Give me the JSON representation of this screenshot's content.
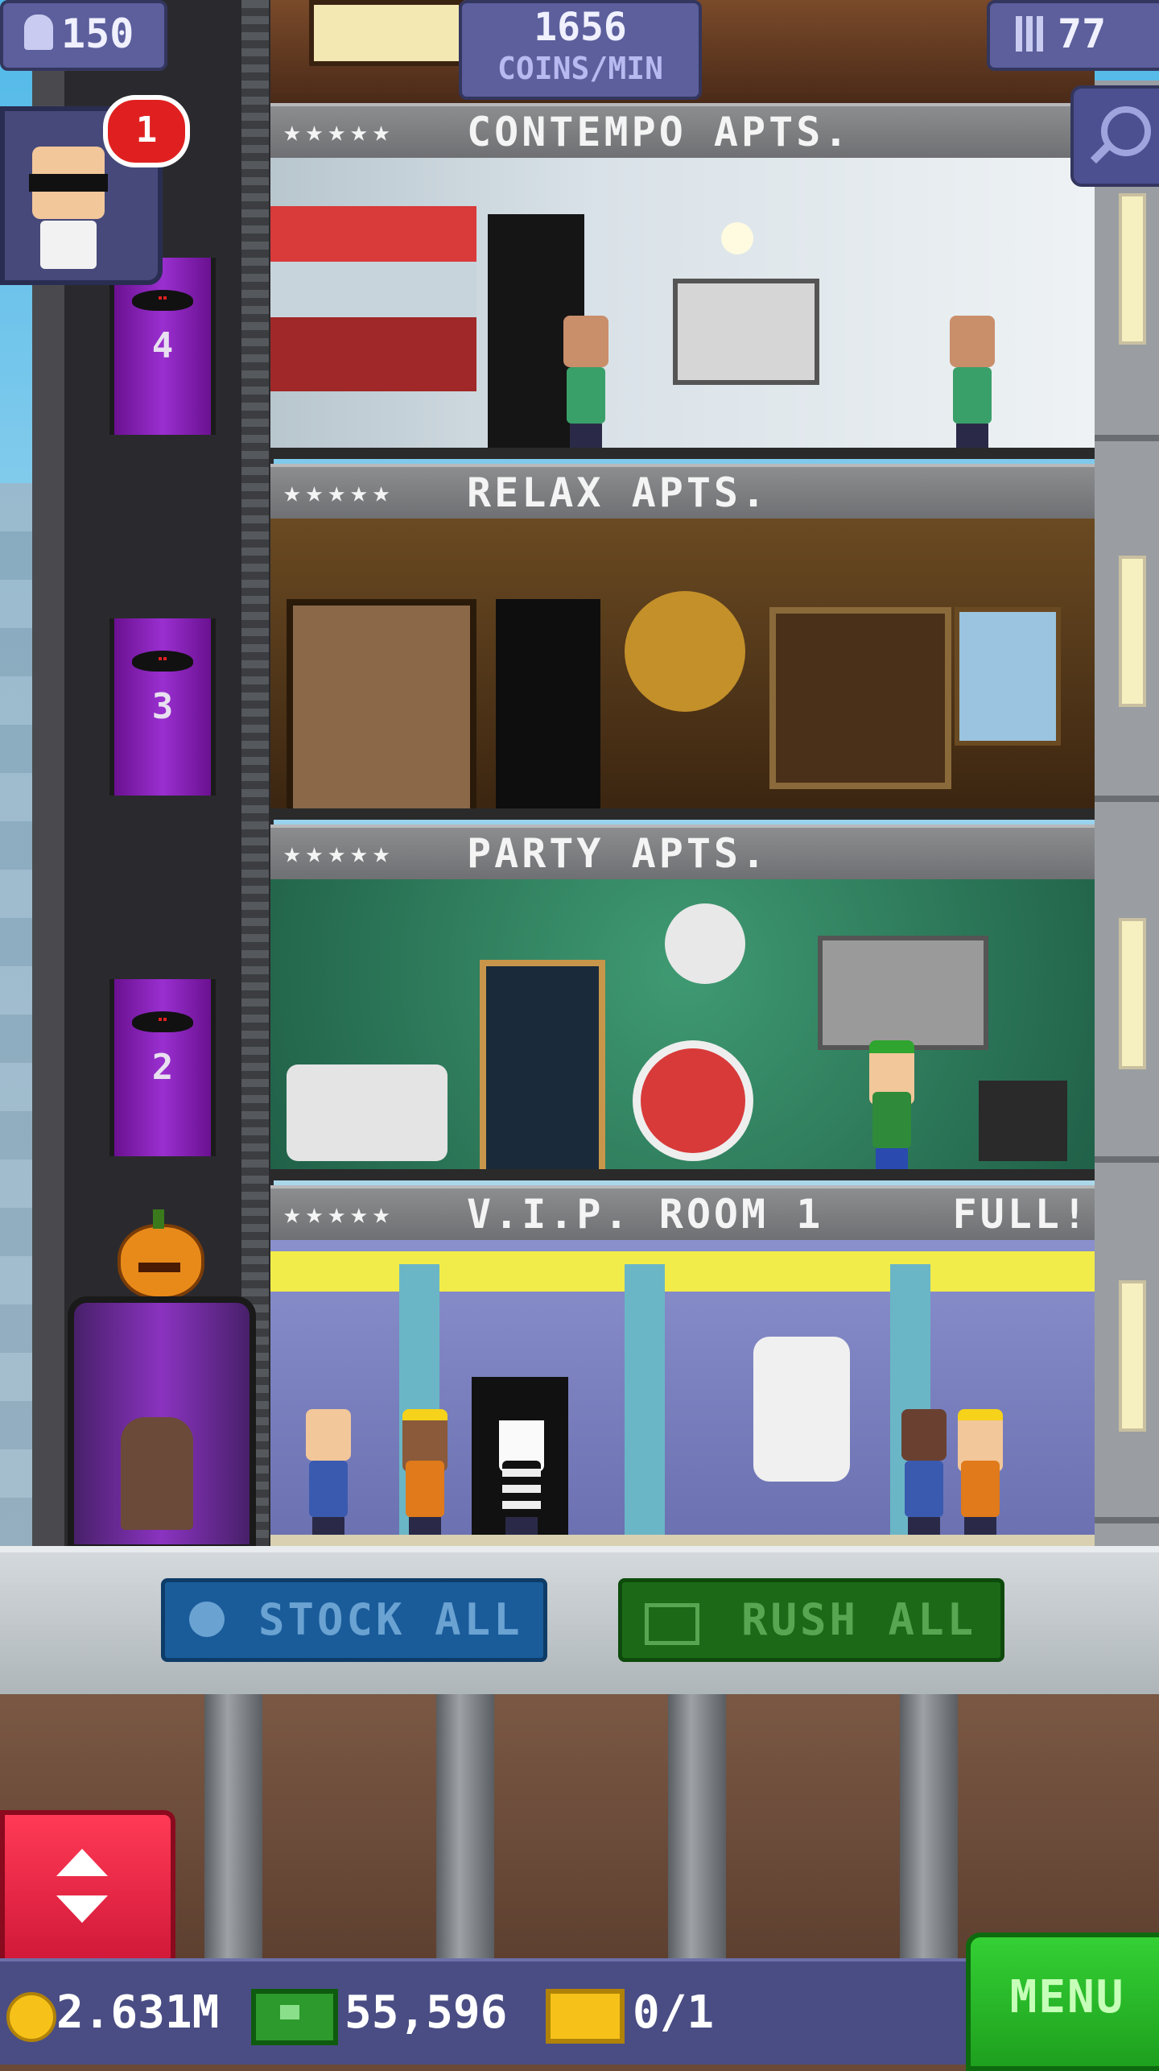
{
  "hud": {
    "population": "150",
    "coins_per_min_value": "1656",
    "coins_per_min_label": "COINS/MIN",
    "floors": "77",
    "notification_count": "1"
  },
  "shaft": {
    "floor_numbers": [
      "4",
      "3",
      "2"
    ]
  },
  "rooms": [
    {
      "name": "CONTEMPO APTS.",
      "stars": "★★★★★",
      "status": ""
    },
    {
      "name": "RELAX APTS.",
      "stars": "★★★★★",
      "status": ""
    },
    {
      "name": "PARTY APTS.",
      "stars": "★★★★★",
      "status": ""
    },
    {
      "name": "V.I.P. ROOM 1",
      "stars": "★★★★★",
      "status": "FULL!"
    }
  ],
  "actions": {
    "stock_all": "STOCK ALL",
    "rush_all": "RUSH ALL"
  },
  "bottom_bar": {
    "coins": "2.631M",
    "bux": "55,596",
    "tickets": "0/1",
    "menu": "MENU"
  },
  "icons": {
    "population": "person-icon",
    "floors": "building-icon",
    "search": "magnifier-icon",
    "stock": "clock-icon",
    "rush": "bux-icon",
    "elevator": "up-down-arrows-icon",
    "coin": "coin-icon",
    "ticket": "golden-ticket-icon"
  },
  "colors": {
    "hud": "#5c5f9c",
    "stock_button": "#1a5c9a",
    "rush_button": "#1c6a18",
    "menu_button": "#22b022",
    "elevator_button": "#e82040",
    "notification_badge": "#e02020"
  }
}
